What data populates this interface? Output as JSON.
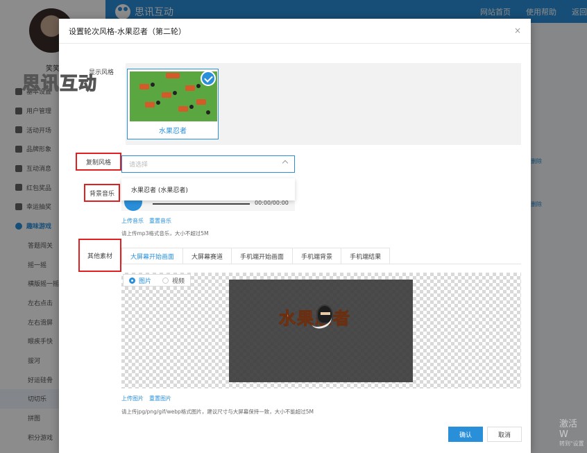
{
  "app": {
    "brand": "思讯互动",
    "top_links": [
      "网站首页",
      "使用帮助",
      "返回"
    ],
    "username": "笑笑",
    "watermark": "思讯互动"
  },
  "sidebar": {
    "items": [
      {
        "label": "基本设置",
        "icon": "gear-icon"
      },
      {
        "label": "用户管理",
        "icon": "user-icon"
      },
      {
        "label": "活动开场",
        "icon": "send-icon"
      },
      {
        "label": "品牌形象",
        "icon": "brand-icon"
      },
      {
        "label": "互动消息",
        "icon": "message-icon"
      },
      {
        "label": "红包奖品",
        "icon": "gift-icon"
      },
      {
        "label": "幸运抽奖",
        "icon": "lottery-icon"
      },
      {
        "label": "趣味游戏",
        "icon": "game-icon"
      }
    ],
    "sub_items": [
      "答题闯关",
      "摇一摇",
      "横版摇一摇",
      "左右点击",
      "左右滑屏",
      "眼疾手快",
      "拔河",
      "好运硅骨",
      "切切乐",
      "拼图",
      "积分游戏"
    ]
  },
  "background_rows": {
    "actions": [
      "删除",
      "删除"
    ]
  },
  "windows_activation": {
    "line1": "激活 W",
    "line2": "转到\"设置"
  },
  "modal": {
    "title": "设置轮次风格-水果忍者（第二轮）",
    "close": "×",
    "display_style_label": "显示风格",
    "style_option": "水果忍者",
    "copy_style_label": "复制风格",
    "select_placeholder": "请选择",
    "dropdown_option": "水果忍者 (水果忍者)",
    "bg_music_label": "背景音乐",
    "audio_time": "00:00/00:00",
    "upload_music": "上传音乐",
    "reset_music": "重置音乐",
    "music_hint": "请上传mp3格式音乐，大小不超过5M",
    "other_material_label": "其他素材",
    "tabs": [
      "大屏幕开始画面",
      "大屏幕赛道",
      "手机端开始画面",
      "手机端背景",
      "手机端结果"
    ],
    "radio_image": "图片",
    "radio_video": "视频",
    "game_title": "水果忍者",
    "upload_image": "上传图片",
    "reset_image": "重置图片",
    "image_hint": "请上传jpg/png/gif/webp格式图片，建议尺寸与大屏幕保持一致，大小不能超过5M",
    "confirm": "确认",
    "cancel": "取消"
  },
  "colors": {
    "accent": "#2a8fd9",
    "highlight_box": "#e02020"
  }
}
